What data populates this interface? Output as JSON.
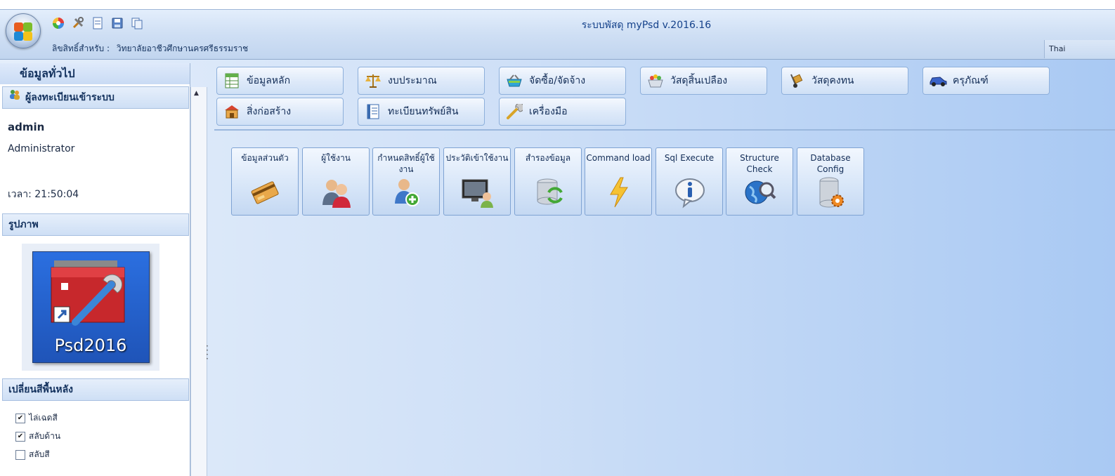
{
  "window": {
    "title": "ระบบพัสดุ myPsd v.2016.16",
    "license_label": "ลิขสิทธิ์สำหรับ :",
    "license_value": "วิทยาลัยอาชีวศึกษานครศรีธรรมราช",
    "language": "Thai"
  },
  "quick_access": [
    "color-wheel-icon",
    "tools-icon",
    "form-icon",
    "save-icon",
    "copy-icon"
  ],
  "left_panel": {
    "title": "ข้อมูลทั่วไป",
    "login_header": "ผู้ลงทะเบียนเข้าระบบ",
    "username": "admin",
    "role": "Administrator",
    "time": "เวลา: 21:50:04",
    "image_header": "รูปภาพ",
    "image_label": "Psd2016",
    "bg_header": "เปลี่ยนสีพื้นหลัง",
    "options": [
      {
        "label": "ไล่เฉดสี",
        "checked": true
      },
      {
        "label": "สลับด้าน",
        "checked": true
      },
      {
        "label": "สลับสี",
        "checked": false
      }
    ]
  },
  "main_menu": [
    {
      "label": "ข้อมูลหลัก",
      "icon": "table-icon"
    },
    {
      "label": "งบประมาณ",
      "icon": "scale-icon"
    },
    {
      "label": "จัดซื้อ/จัดจ้าง",
      "icon": "basket-icon"
    },
    {
      "label": "วัสดุสิ้นเปลือง",
      "icon": "supplies-icon"
    },
    {
      "label": "วัสดุคงทน",
      "icon": "hand-truck-icon"
    },
    {
      "label": "ครุภัณฑ์",
      "icon": "car-icon"
    },
    {
      "label": "สิ่งก่อสร้าง",
      "icon": "building-icon"
    },
    {
      "label": "ทะเบียนทรัพย์สิน",
      "icon": "ledger-icon"
    },
    {
      "label": "เครื่องมือ",
      "icon": "wrench-icon"
    }
  ],
  "sub_tools": [
    {
      "label": "ข้อมูลส่วนตัว",
      "icon": "id-card-icon"
    },
    {
      "label": "ผู้ใช้งาน",
      "icon": "users-icon"
    },
    {
      "label": "กำหนดสิทธิ์ผู้ใช้งาน",
      "icon": "add-user-icon"
    },
    {
      "label": "ประวัติเข้าใช้งาน",
      "icon": "monitor-user-icon"
    },
    {
      "label": "สำรองข้อมูล",
      "icon": "db-sync-icon"
    },
    {
      "label": "Command load",
      "icon": "lightning-icon"
    },
    {
      "label": "Sql Execute",
      "icon": "info-icon"
    },
    {
      "label": "Structure Check",
      "icon": "globe-search-icon"
    },
    {
      "label": "Database Config",
      "icon": "db-gear-icon"
    }
  ],
  "colors": {
    "accent": "#15428b",
    "panel_header": "#cedff5",
    "background": "#a9c9f3"
  }
}
